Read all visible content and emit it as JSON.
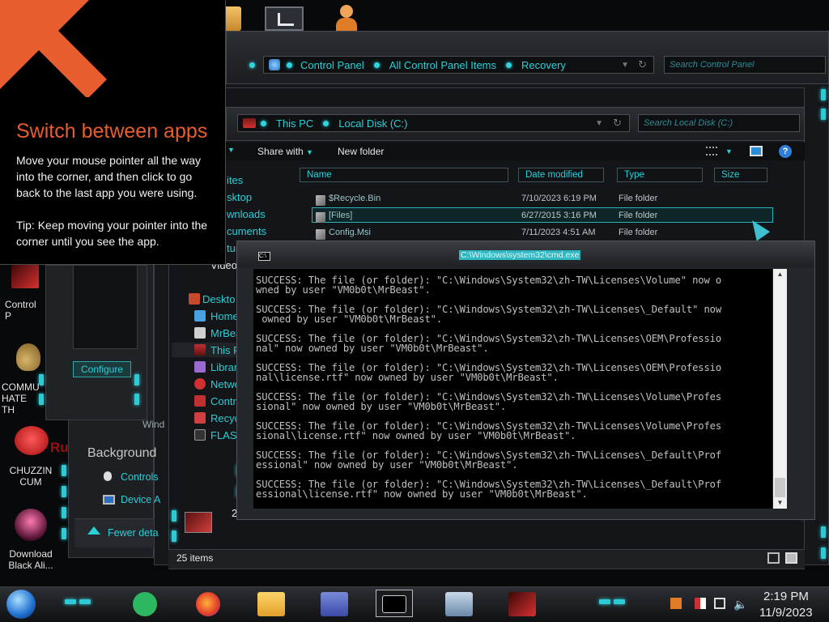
{
  "tip": {
    "title": "Switch between apps",
    "body": "Move your mouse pointer all the way into the corner, and then click to go back to the last app you were using.",
    "hint": "Tip: Keep moving your pointer into the corner until you see the app."
  },
  "control_panel_window": {
    "breadcrumb": [
      "Control Panel",
      "All Control Panel Items",
      "Recovery"
    ],
    "search_placeholder": "Search Control Panel",
    "sidebar_item": "Control Panel",
    "left_links": [
      "Background",
      "Controls",
      "Device A"
    ],
    "fewer_details": "Fewer deta",
    "configure_button": "Configure"
  },
  "explorer_window": {
    "breadcrumb": [
      "This PC",
      "Local Disk (C:)"
    ],
    "search_placeholder": "Search Local Disk (C:)",
    "toolbar": {
      "share_with": "Share with",
      "new_folder": "New folder"
    },
    "columns": [
      "Name",
      "Date modified",
      "Type",
      "Size"
    ],
    "files": [
      {
        "name": "$Recycle.Bin",
        "date": "7/10/2023 6:19 PM",
        "type": "File folder"
      },
      {
        "name": "[Files]",
        "date": "6/27/2015 3:16 PM",
        "type": "File folder"
      },
      {
        "name": "Config.Msi",
        "date": "7/11/2023 4:51 AM",
        "type": "File folder"
      }
    ],
    "nav_partial": [
      "ites",
      "sktop",
      "wnloads",
      "cuments",
      "tur",
      "Video"
    ],
    "nav_tree": [
      "Deskto",
      "Homeg",
      "MrBea",
      "This P",
      "Librari",
      "Netwo",
      "Contro",
      "Recyc",
      "FLASH"
    ],
    "window_label": "Wind",
    "count_partial": "25",
    "status": "25 items"
  },
  "cmd_window": {
    "title": "C:\\Windows\\system32\\cmd.exe",
    "lines": [
      "SUCCESS: The file (or folder): \"C:\\Windows\\System32\\zh-TW\\Licenses\\Volume\" now o",
      "wned by user \"VM0b0t\\MrBeast\".",
      "",
      "SUCCESS: The file (or folder): \"C:\\Windows\\System32\\zh-TW\\Licenses\\_Default\" now",
      " owned by user \"VM0b0t\\MrBeast\".",
      "",
      "SUCCESS: The file (or folder): \"C:\\Windows\\System32\\zh-TW\\Licenses\\OEM\\Professio",
      "nal\" now owned by user \"VM0b0t\\MrBeast\".",
      "",
      "SUCCESS: The file (or folder): \"C:\\Windows\\System32\\zh-TW\\Licenses\\OEM\\Professio",
      "nal\\license.rtf\" now owned by user \"VM0b0t\\MrBeast\".",
      "",
      "SUCCESS: The file (or folder): \"C:\\Windows\\System32\\zh-TW\\Licenses\\Volume\\Profes",
      "sional\" now owned by user \"VM0b0t\\MrBeast\".",
      "",
      "SUCCESS: The file (or folder): \"C:\\Windows\\System32\\zh-TW\\Licenses\\Volume\\Profes",
      "sional\\license.rtf\" now owned by user \"VM0b0t\\MrBeast\".",
      "",
      "SUCCESS: The file (or folder): \"C:\\Windows\\System32\\zh-TW\\Licenses\\_Default\\Prof",
      "essional\" now owned by user \"VM0b0t\\MrBeast\".",
      "",
      "SUCCESS: The file (or folder): \"C:\\Windows\\System32\\zh-TW\\Licenses\\_Default\\Prof",
      "essional\\license.rtf\" now owned by user \"VM0b0t\\MrBeast\"."
    ]
  },
  "desktop_icons": [
    {
      "label": "Control P",
      "icon": "control-panel-icon"
    },
    {
      "label": "COMMU\nHATE TH",
      "icon": "money-bag-icon"
    },
    {
      "label": "CHUZZIN\nCUM",
      "icon": "chuzzle-icon"
    },
    {
      "label": "Download\nBlack Ali...",
      "icon": "alienware-icon"
    }
  ],
  "desktop_partial_text": "Ru",
  "taskbar": {
    "apps": [
      "start-orb-icon",
      "notes-icon",
      "firefox-icon",
      "file-explorer-icon",
      "control-panel-icon",
      "cmd-icon",
      "monitor-icon",
      "alienware-icon"
    ],
    "time": "2:19 PM",
    "date": "11/9/2023",
    "tray": [
      "language-icon",
      "flag-icon",
      "network-icon",
      "volume-icon"
    ]
  },
  "colors": {
    "accent": "#28d0d8",
    "tip_title": "#e85d2e",
    "background": "#08090b"
  }
}
